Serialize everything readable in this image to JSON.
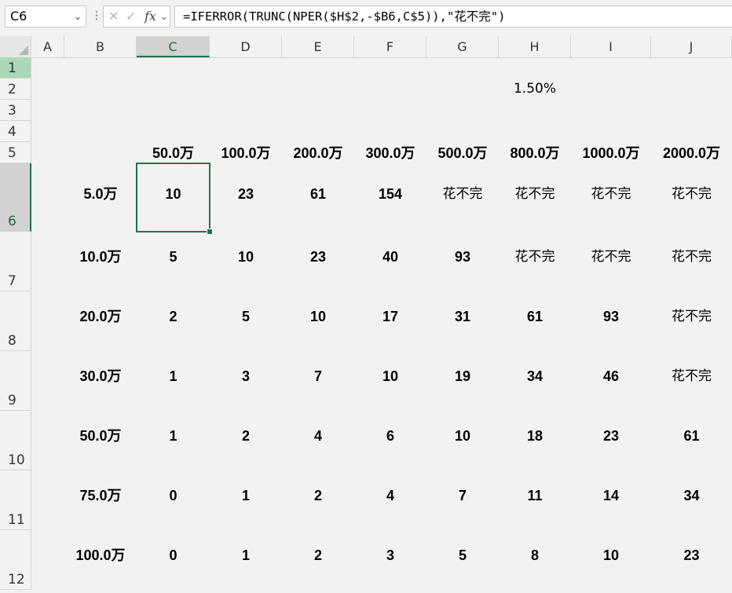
{
  "formula_bar": {
    "name_box": "C6",
    "formula": "=IFERROR(TRUNC(NPER($H$2,-$B6,C$5)),\"花不完\")",
    "cancel_icon": "x-icon",
    "enter_icon": "check-icon",
    "function_icon": "fx-icon",
    "fx_label": "fx"
  },
  "columns": [
    "A",
    "B",
    "C",
    "D",
    "E",
    "F",
    "G",
    "H",
    "I",
    "J"
  ],
  "selected_cell": "C6",
  "rate_cell": {
    "ref": "H2",
    "value": "1.50%"
  },
  "header_row": {
    "row": 5,
    "values": [
      "50.0万",
      "100.0万",
      "200.0万",
      "300.0万",
      "500.0万",
      "800.0万",
      "1000.0万",
      "2000.0万"
    ]
  },
  "rows": [
    {
      "row": 6,
      "label": "5.0万",
      "values": [
        "10",
        "23",
        "61",
        "154",
        "花不完",
        "花不完",
        "花不完",
        "花不完"
      ]
    },
    {
      "row": 7,
      "label": "10.0万",
      "values": [
        "5",
        "10",
        "23",
        "40",
        "93",
        "花不完",
        "花不完",
        "花不完"
      ]
    },
    {
      "row": 8,
      "label": "20.0万",
      "values": [
        "2",
        "5",
        "10",
        "17",
        "31",
        "61",
        "93",
        "花不完"
      ]
    },
    {
      "row": 9,
      "label": "30.0万",
      "values": [
        "1",
        "3",
        "7",
        "10",
        "19",
        "34",
        "46",
        "花不完"
      ]
    },
    {
      "row": 10,
      "label": "50.0万",
      "values": [
        "1",
        "2",
        "4",
        "6",
        "10",
        "18",
        "23",
        "61"
      ]
    },
    {
      "row": 11,
      "label": "75.0万",
      "values": [
        "0",
        "1",
        "2",
        "4",
        "7",
        "11",
        "14",
        "34"
      ]
    },
    {
      "row": 12,
      "label": "100.0万",
      "values": [
        "0",
        "1",
        "2",
        "3",
        "5",
        "8",
        "10",
        "23"
      ]
    }
  ],
  "row_numbers": [
    "1",
    "2",
    "3",
    "4",
    "5",
    "6",
    "7",
    "8",
    "9",
    "10",
    "11",
    "12"
  ],
  "colors": {
    "accent": "#217346",
    "selected_header_bg": "#d2d2d2",
    "highlight_row_header": "#a9d8b8"
  }
}
